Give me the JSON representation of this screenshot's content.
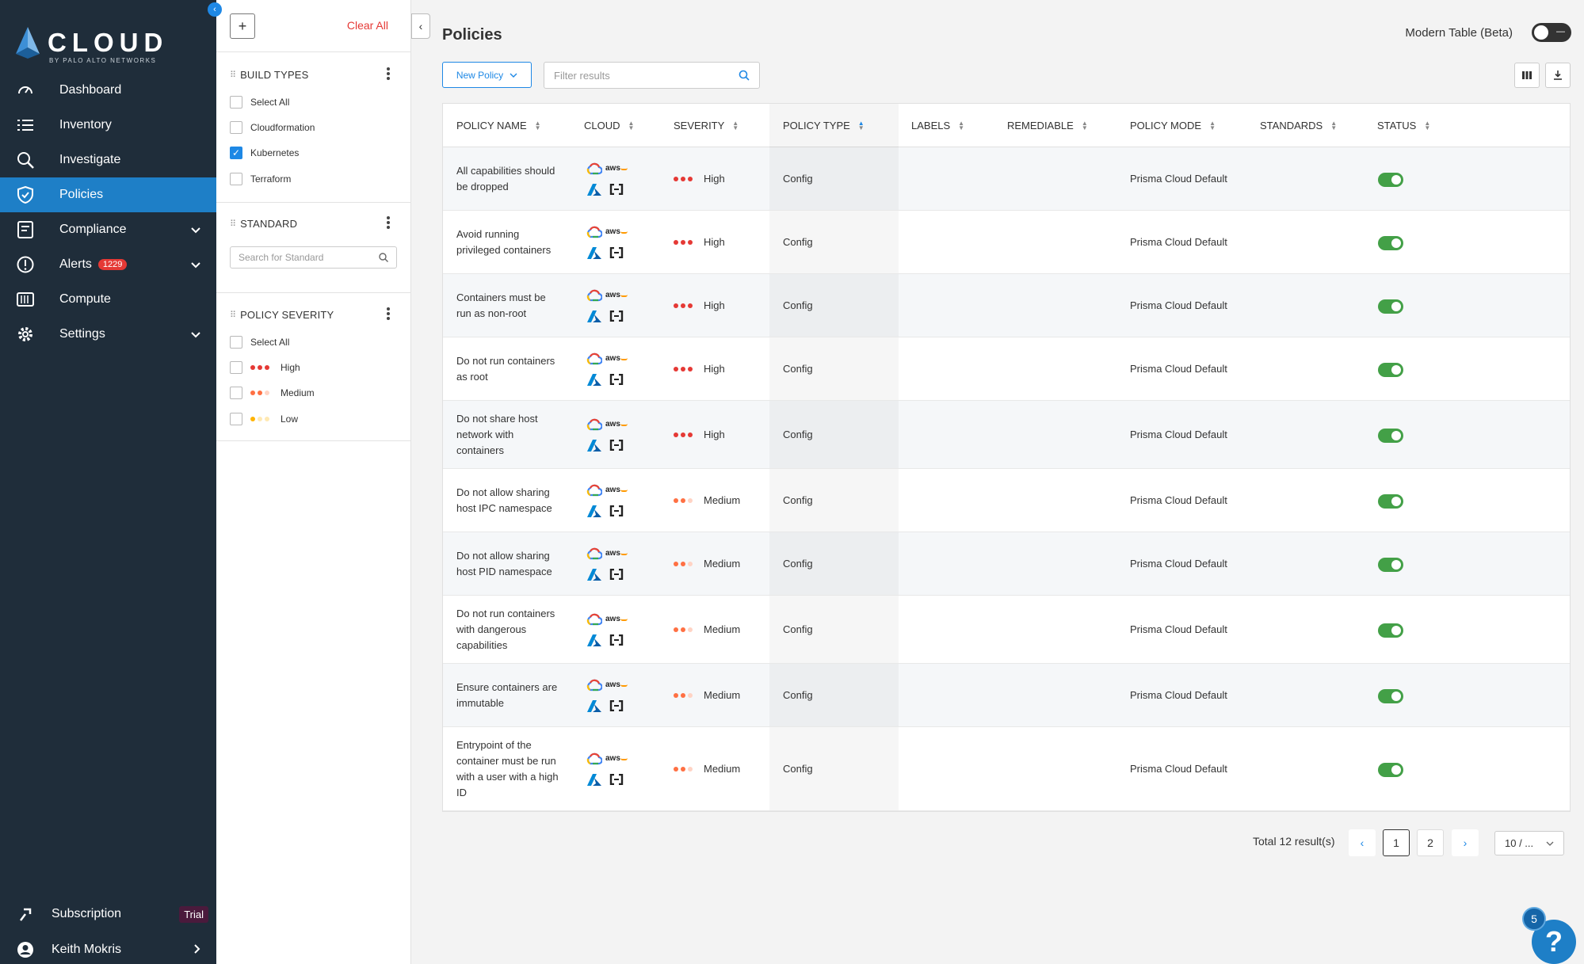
{
  "brand": {
    "name": "CLOUD",
    "tagline": "BY PALO ALTO NETWORKS"
  },
  "sidebar": {
    "items": [
      {
        "label": "Dashboard",
        "icon": "gauge-icon"
      },
      {
        "label": "Inventory",
        "icon": "list-icon"
      },
      {
        "label": "Investigate",
        "icon": "search-icon"
      },
      {
        "label": "Policies",
        "icon": "shield-icon",
        "active": true
      },
      {
        "label": "Compliance",
        "icon": "report-icon"
      },
      {
        "label": "Alerts",
        "icon": "alert-icon",
        "badge": "1229"
      },
      {
        "label": "Compute",
        "icon": "compute-icon"
      },
      {
        "label": "Settings",
        "icon": "gear-icon"
      }
    ],
    "subscription": {
      "label": "Subscription",
      "badge": "Trial"
    },
    "user": {
      "name": "Keith Mokris"
    }
  },
  "filters": {
    "add_label": "+",
    "clear_all": "Clear All",
    "build_types": {
      "title": "BUILD TYPES",
      "options": [
        {
          "label": "Select All",
          "checked": false
        },
        {
          "label": "Cloudformation",
          "checked": false
        },
        {
          "label": "Kubernetes",
          "checked": true
        },
        {
          "label": "Terraform",
          "checked": false
        }
      ]
    },
    "standard": {
      "title": "STANDARD",
      "placeholder": "Search for Standard"
    },
    "severity": {
      "title": "POLICY SEVERITY",
      "options": [
        {
          "label": "Select All"
        },
        {
          "label": "High"
        },
        {
          "label": "Medium"
        },
        {
          "label": "Low"
        }
      ]
    }
  },
  "main": {
    "title": "Policies",
    "modern_table_label": "Modern Table (Beta)",
    "new_policy_label": "New Policy",
    "filter_placeholder": "Filter results",
    "columns": [
      "POLICY NAME",
      "CLOUD",
      "SEVERITY",
      "POLICY TYPE",
      "LABELS",
      "REMEDIABLE",
      "POLICY MODE",
      "STANDARDS",
      "STATUS"
    ],
    "rows": [
      {
        "name": "All capabilities should be dropped",
        "severity": "High",
        "type": "Config",
        "mode": "Prisma Cloud Default",
        "enabled": true
      },
      {
        "name": "Avoid running privileged containers",
        "severity": "High",
        "type": "Config",
        "mode": "Prisma Cloud Default",
        "enabled": true
      },
      {
        "name": "Containers must be run as non-root",
        "severity": "High",
        "type": "Config",
        "mode": "Prisma Cloud Default",
        "enabled": true
      },
      {
        "name": "Do not run containers as root",
        "severity": "High",
        "type": "Config",
        "mode": "Prisma Cloud Default",
        "enabled": true
      },
      {
        "name": "Do not share host network with containers",
        "severity": "High",
        "type": "Config",
        "mode": "Prisma Cloud Default",
        "enabled": true
      },
      {
        "name": "Do not allow sharing host IPC namespace",
        "severity": "Medium",
        "type": "Config",
        "mode": "Prisma Cloud Default",
        "enabled": true
      },
      {
        "name": "Do not allow sharing host PID namespace",
        "severity": "Medium",
        "type": "Config",
        "mode": "Prisma Cloud Default",
        "enabled": true
      },
      {
        "name": "Do not run containers with dangerous capabilities",
        "severity": "Medium",
        "type": "Config",
        "mode": "Prisma Cloud Default",
        "enabled": true
      },
      {
        "name": "Ensure containers are immutable",
        "severity": "Medium",
        "type": "Config",
        "mode": "Prisma Cloud Default",
        "enabled": true
      },
      {
        "name": "Entrypoint of the container must be run with a user with a high ID",
        "severity": "Medium",
        "type": "Config",
        "mode": "Prisma Cloud Default",
        "enabled": true
      }
    ],
    "pagination": {
      "total": "Total 12 result(s)",
      "pages": [
        "1",
        "2"
      ],
      "current": "1",
      "page_size": "10 / ..."
    }
  },
  "help": {
    "label": "?",
    "badge": "5"
  },
  "colors": {
    "sidebar": "#1f2d3a",
    "active": "#1e7fc7",
    "high": "#e53935",
    "medium": "#ff7043",
    "low": "#ffb300",
    "toggle_on": "#43a047"
  }
}
